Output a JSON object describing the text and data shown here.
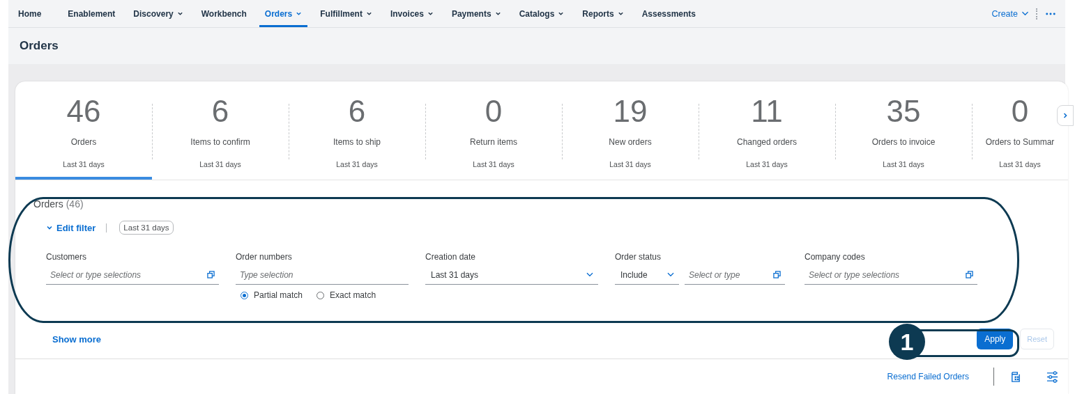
{
  "nav": {
    "items": [
      {
        "label": "Home",
        "has_menu": false,
        "selected": false
      },
      {
        "label": "Enablement",
        "has_menu": false,
        "selected": false
      },
      {
        "label": "Discovery",
        "has_menu": true,
        "selected": false
      },
      {
        "label": "Workbench",
        "has_menu": false,
        "selected": false
      },
      {
        "label": "Orders",
        "has_menu": true,
        "selected": true
      },
      {
        "label": "Fulfillment",
        "has_menu": true,
        "selected": false
      },
      {
        "label": "Invoices",
        "has_menu": true,
        "selected": false
      },
      {
        "label": "Payments",
        "has_menu": true,
        "selected": false
      },
      {
        "label": "Catalogs",
        "has_menu": true,
        "selected": false
      },
      {
        "label": "Reports",
        "has_menu": true,
        "selected": false
      },
      {
        "label": "Assessments",
        "has_menu": false,
        "selected": false
      }
    ],
    "create": "Create"
  },
  "page_title": "Orders",
  "kpis": [
    {
      "value": "46",
      "label": "Orders",
      "period": "Last 31 days",
      "selected": true
    },
    {
      "value": "6",
      "label": "Items to confirm",
      "period": "Last 31 days",
      "selected": false
    },
    {
      "value": "6",
      "label": "Items to ship",
      "period": "Last 31 days",
      "selected": false
    },
    {
      "value": "0",
      "label": "Return items",
      "period": "Last 31 days",
      "selected": false
    },
    {
      "value": "19",
      "label": "New orders",
      "period": "Last 31 days",
      "selected": false
    },
    {
      "value": "11",
      "label": "Changed orders",
      "period": "Last 31 days",
      "selected": false
    },
    {
      "value": "35",
      "label": "Orders to invoice",
      "period": "Last 31 days",
      "selected": false
    },
    {
      "value": "0",
      "label": "Orders to Summar",
      "period": "Last 31 days",
      "selected": false
    }
  ],
  "filter": {
    "title": "Orders",
    "count": "(46)",
    "toggle": "Edit filter",
    "expanded": true,
    "chip": "Last 31 days",
    "fields": [
      {
        "kind": "multi",
        "label": "Customers",
        "placeholder": "Select or type selections"
      },
      {
        "kind": "text",
        "label": "Order numbers",
        "placeholder": "Type selection",
        "match_options": [
          {
            "label": "Partial match",
            "selected": true
          },
          {
            "label": "Exact match",
            "selected": false
          }
        ]
      },
      {
        "kind": "select",
        "label": "Creation date",
        "value": "Last 31 days"
      },
      {
        "kind": "status",
        "label": "Order status",
        "operator": "Include",
        "placeholder": "Select or type"
      },
      {
        "kind": "multi",
        "label": "Company codes",
        "placeholder": "Select or type selections"
      }
    ],
    "show_more": "Show more",
    "apply": "Apply",
    "reset": {
      "label": "Reset",
      "disabled": true
    }
  },
  "toolbar": {
    "link": "Resend Failed Orders"
  },
  "callouts": [
    {
      "number": "1"
    }
  ]
}
